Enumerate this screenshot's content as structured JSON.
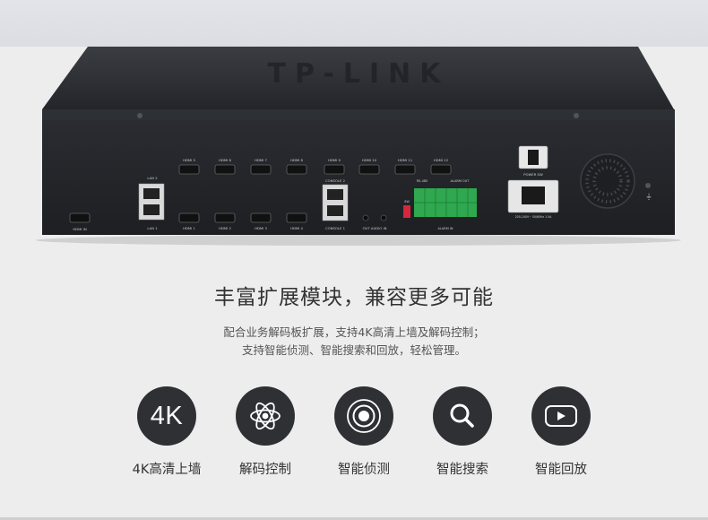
{
  "device": {
    "ports_top": [
      "HDMI 5",
      "HDMI 6",
      "HDMI 7",
      "HDMI 8",
      "HDMI 9",
      "HDMI 10",
      "HDMI 11",
      "HDMI 12"
    ],
    "ports_bottom": [
      "HDMI 1",
      "HDMI 2",
      "HDMI 3",
      "HDMI 4"
    ],
    "hdmi_in": "HDMI IN",
    "lan2": "LAN 2",
    "lan1": "LAN 1",
    "console2": "CONSOLE 2",
    "console1": "CONSOLE 1",
    "audio": "OUT  AUDIO  IN",
    "rs485": "RS-485",
    "alarm_out": "ALARM OUT",
    "alarm_in": "ALARM IN",
    "power_sw": "POWER SW",
    "power_spec": "200-240V~ 50/60Hz 1.5A",
    "sw": "SW",
    "brand": "TP-LINK"
  },
  "heading": "丰富扩展模块，兼容更多可能",
  "description": [
    "配合业务解码板扩展，支持4K高清上墙及解码控制；",
    "支持智能侦测、智能搜索和回放，轻松管理。"
  ],
  "features": [
    {
      "icon": "4k-icon",
      "badge": "4K",
      "label": "4K高清上墙"
    },
    {
      "icon": "atom-icon",
      "label": "解码控制"
    },
    {
      "icon": "target-icon",
      "label": "智能侦测"
    },
    {
      "icon": "search-icon",
      "label": "智能搜索"
    },
    {
      "icon": "play-icon",
      "label": "智能回放"
    }
  ],
  "colors": {
    "background": "#ededed",
    "device_body": "#25272b",
    "icon_circle": "#2f3034",
    "terminal_green": "#2fa84f"
  }
}
